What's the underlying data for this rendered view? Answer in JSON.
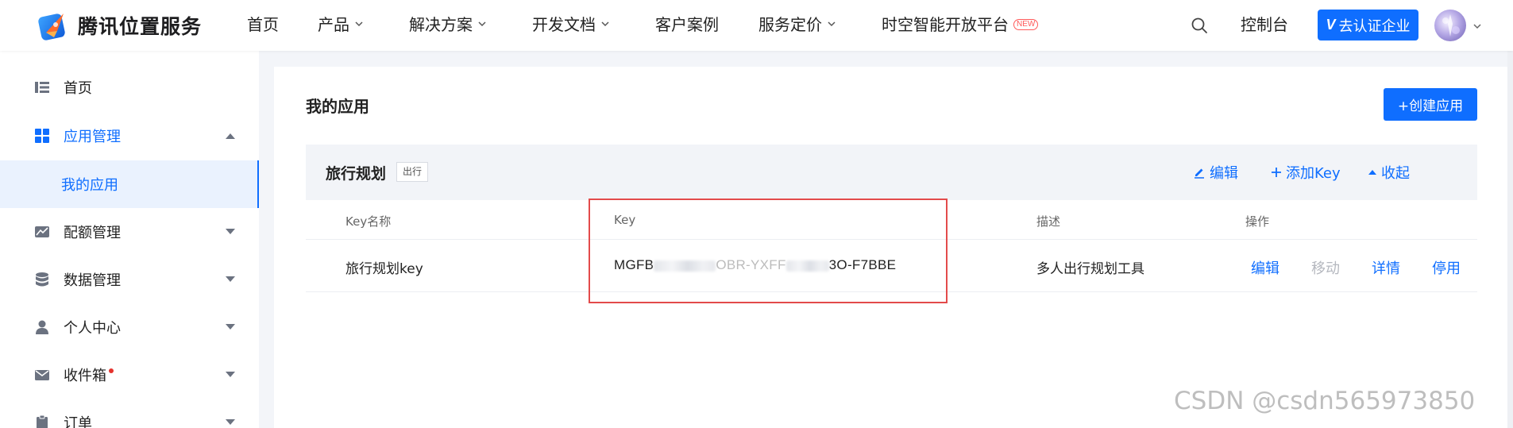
{
  "brand": {
    "name": "腾讯位置服务"
  },
  "nav": {
    "items": [
      {
        "label": "首页",
        "has_dropdown": false
      },
      {
        "label": "产品",
        "has_dropdown": true
      },
      {
        "label": "解决方案",
        "has_dropdown": true
      },
      {
        "label": "开发文档",
        "has_dropdown": true
      },
      {
        "label": "客户案例",
        "has_dropdown": false
      },
      {
        "label": "服务定价",
        "has_dropdown": true
      },
      {
        "label": "时空智能开放平台",
        "has_dropdown": false,
        "badge": "NEW"
      }
    ],
    "console_label": "控制台",
    "verify_badge": "V",
    "verify_label": "去认证企业"
  },
  "sidebar": {
    "items": [
      {
        "label": "首页",
        "icon": "list-icon"
      },
      {
        "label": "应用管理",
        "icon": "grid-icon",
        "expanded": true,
        "active": true
      },
      {
        "label": "配额管理",
        "icon": "chart-icon"
      },
      {
        "label": "数据管理",
        "icon": "database-icon"
      },
      {
        "label": "个人中心",
        "icon": "user-icon"
      },
      {
        "label": "收件箱",
        "icon": "mail-icon",
        "unread_dot": true
      },
      {
        "label": "订单",
        "icon": "clipboard-icon"
      }
    ],
    "sub_item": {
      "label": "我的应用",
      "active": true
    }
  },
  "main": {
    "title": "我的应用",
    "create_button": "+创建应用",
    "app": {
      "name": "旅行规划",
      "tag": "出行",
      "actions": {
        "edit": "编辑",
        "add_key": "添加Key",
        "collapse": "收起"
      }
    },
    "table": {
      "headers": [
        "Key名称",
        "Key",
        "描述",
        "操作"
      ],
      "rows": [
        {
          "key_name": "旅行规划key",
          "key_prefix": "MGFB",
          "key_mid": "OBR-YXFF",
          "key_suffix": "3O-F7BBE",
          "description": "多人出行规划工具",
          "ops": {
            "edit": "编辑",
            "move": "移动",
            "detail": "详情",
            "disable": "停用"
          }
        }
      ]
    }
  },
  "watermark": "CSDN @csdn565973850",
  "colors": {
    "accent": "#0f6eff",
    "highlight": "#e34b4b",
    "side_active_bg": "#eaf2fe",
    "badge_red": "#ff5a5a"
  }
}
